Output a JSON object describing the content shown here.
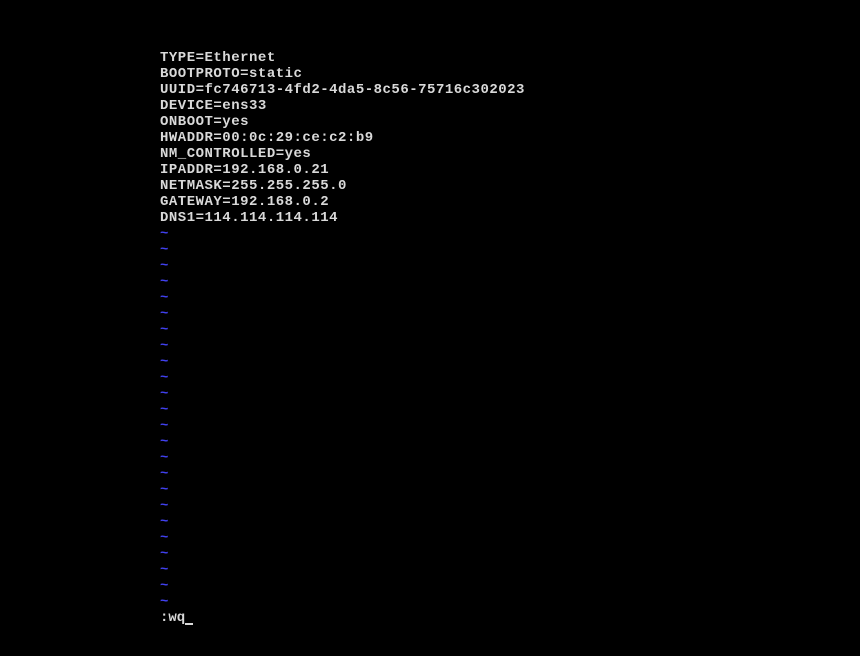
{
  "config": {
    "lines": [
      "TYPE=Ethernet",
      "BOOTPROTO=static",
      "UUID=fc746713-4fd2-4da5-8c56-75716c302023",
      "DEVICE=ens33",
      "ONBOOT=yes",
      "HWADDR=00:0c:29:ce:c2:b9",
      "NM_CONTROLLED=yes",
      "IPADDR=192.168.0.21",
      "NETMASK=255.255.255.0",
      "GATEWAY=192.168.0.2",
      "DNS1=114.114.114.114"
    ]
  },
  "tilde_marker": "~",
  "tilde_count": 24,
  "command": ":wq"
}
